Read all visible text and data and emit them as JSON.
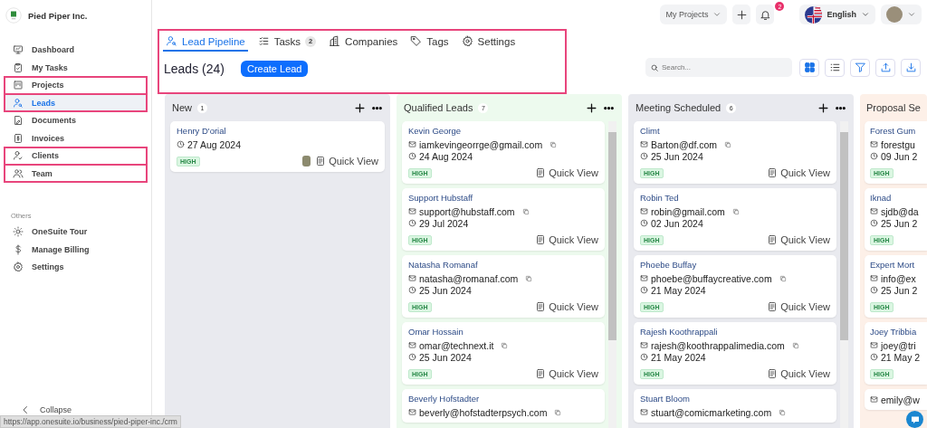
{
  "company": {
    "name": "Pied Piper Inc."
  },
  "sidebar": {
    "items": [
      {
        "label": "Dashboard",
        "selected": false,
        "highlighted": false
      },
      {
        "label": "My Tasks",
        "selected": false,
        "highlighted": false
      },
      {
        "label": "Projects",
        "selected": false,
        "highlighted": true
      },
      {
        "label": "Leads",
        "selected": true,
        "highlighted": true
      },
      {
        "label": "Documents",
        "selected": false,
        "highlighted": false
      },
      {
        "label": "Invoices",
        "selected": false,
        "highlighted": false
      },
      {
        "label": "Clients",
        "selected": false,
        "highlighted": true
      },
      {
        "label": "Team",
        "selected": false,
        "highlighted": true
      }
    ],
    "others_label": "Others",
    "others": [
      {
        "label": "OneSuite Tour"
      },
      {
        "label": "Manage Billing"
      },
      {
        "label": "Settings"
      }
    ],
    "collapse": "Collapse"
  },
  "topbar": {
    "project_menu": "My Projects",
    "notification_count": "2",
    "language": "English"
  },
  "header": {
    "highlighted": true,
    "tabs": [
      {
        "label": "Lead Pipeline",
        "selected": true
      },
      {
        "label": "Tasks",
        "badge": "2",
        "selected": false
      },
      {
        "label": "Companies",
        "selected": false
      },
      {
        "label": "Tags",
        "selected": false
      },
      {
        "label": "Settings",
        "selected": false
      }
    ],
    "title": "Leads (24)",
    "create_button": "Create Lead"
  },
  "toolbar": {
    "search_placeholder": "Search...",
    "views": [
      {
        "selected": true
      },
      {
        "selected": false
      }
    ]
  },
  "columns": [
    {
      "title": "New",
      "count": "1",
      "color": "#e9eaef",
      "cards": [
        {
          "name": "Henry D'orial",
          "date": "27 Aug 2024",
          "priority": "HIGH",
          "avatar": true,
          "action": "Quick View"
        }
      ]
    },
    {
      "title": "Qualified Leads",
      "count": "7",
      "color": "#edfaee",
      "cards": [
        {
          "name": "Kevin George",
          "email": "iamkevingeorrge@gmail.com",
          "date": "24 Aug 2024",
          "priority": "HIGH",
          "action": "Quick View"
        },
        {
          "name": "Support Hubstaff",
          "email": "support@hubstaff.com",
          "date": "29 Jul 2024",
          "priority": "HIGH",
          "action": "Quick View"
        },
        {
          "name": "Natasha Romanaf",
          "email": "natasha@romanaf.com",
          "date": "25 Jun 2024",
          "priority": "HIGH",
          "action": "Quick View"
        },
        {
          "name": "Omar Hossain",
          "email": "omar@technext.it",
          "date": "25 Jun 2024",
          "priority": "HIGH",
          "action": "Quick View"
        },
        {
          "name": "Beverly Hofstadter",
          "email": "beverly@hofstadterpsych.com"
        }
      ]
    },
    {
      "title": "Meeting Scheduled",
      "count": "6",
      "color": "#e9eaef",
      "cards": [
        {
          "name": "Climt",
          "email": "Barton@df.com",
          "date": "25 Jun 2024",
          "priority": "HIGH",
          "action": "Quick View"
        },
        {
          "name": "Robin Ted",
          "email": "robin@gmail.com",
          "date": "02 Jun 2024",
          "priority": "HIGH",
          "action": "Quick View"
        },
        {
          "name": "Phoebe Buffay",
          "email": "phoebe@buffaycreative.com",
          "date": "21 May 2024",
          "priority": "HIGH",
          "action": "Quick View"
        },
        {
          "name": "Rajesh Koothrappali",
          "email": "rajesh@koothrappalimedia.com",
          "date": "21 May 2024",
          "priority": "HIGH",
          "action": "Quick View"
        },
        {
          "name": "Stuart Bloom",
          "email": "stuart@comicmarketing.com"
        }
      ]
    },
    {
      "title": "Proposal Se",
      "color": "#fdf0e8",
      "cards": [
        {
          "name": "Forest Gum",
          "email": "forestgu",
          "date": "09 Jun 2",
          "priority": "HIGH"
        },
        {
          "name": "Iknad",
          "email": "sjdb@da",
          "date": "25 Jun 2",
          "priority": "HIGH"
        },
        {
          "name": "Expert Mort",
          "email": "info@ex",
          "date": "25 Jun 2",
          "priority": "HIGH"
        },
        {
          "name": "Joey Tribbia",
          "email": "joey@tri",
          "date": "21 May 2",
          "priority": "HIGH"
        },
        {
          "email": "emily@w"
        }
      ]
    }
  ],
  "status_bar": "https://app.onesuite.io/business/pied-piper-inc./crm"
}
